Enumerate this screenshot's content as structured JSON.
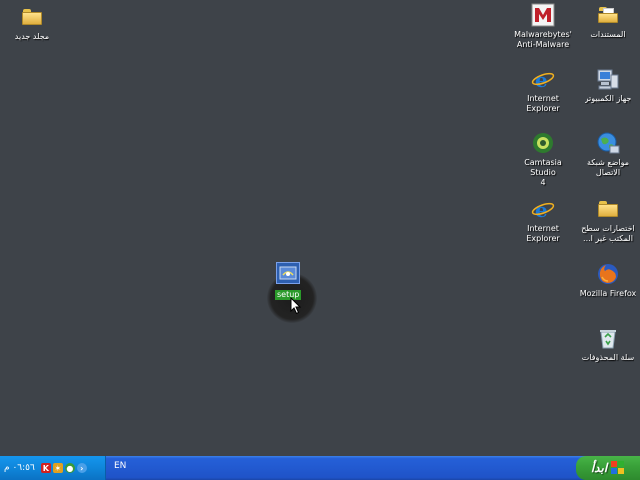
{
  "desktop": {
    "left_icons": [
      {
        "id": "new-folder",
        "label": "مجلد جديد"
      }
    ],
    "right_col_a": [
      {
        "id": "my-documents",
        "label": "المستندات"
      },
      {
        "id": "my-computer",
        "label": "جهاز الكمبيوتر"
      },
      {
        "id": "network-places",
        "label": "مواضع شبكة\nالاتصال"
      },
      {
        "id": "desktop-shortcuts",
        "label": "اختصارات سطح\nالمكتب غير ا..."
      },
      {
        "id": "mozilla-firefox",
        "label": "Mozilla Firefox"
      },
      {
        "id": "recycle-bin",
        "label": "سلة المحذوفات"
      }
    ],
    "right_col_b": [
      {
        "id": "malwarebytes",
        "label": "Malwarebytes'\nAnti-Malware"
      },
      {
        "id": "internet-explorer-1",
        "label": "Internet\nExplorer"
      },
      {
        "id": "camtasia",
        "label": "Camtasia Studio\n4"
      },
      {
        "id": "internet-explorer-2",
        "label": "Internet\nExplorer"
      }
    ],
    "selected_icon": {
      "id": "setup",
      "label": "setup"
    }
  },
  "taskbar": {
    "clock": "٠٦:٥٦ م",
    "language": "EN",
    "start_label": "ابدأ"
  },
  "colors": {
    "desktop_bg": "#3e4349",
    "taskbar_blue": "#2560d8",
    "start_green": "#3aa23a"
  }
}
